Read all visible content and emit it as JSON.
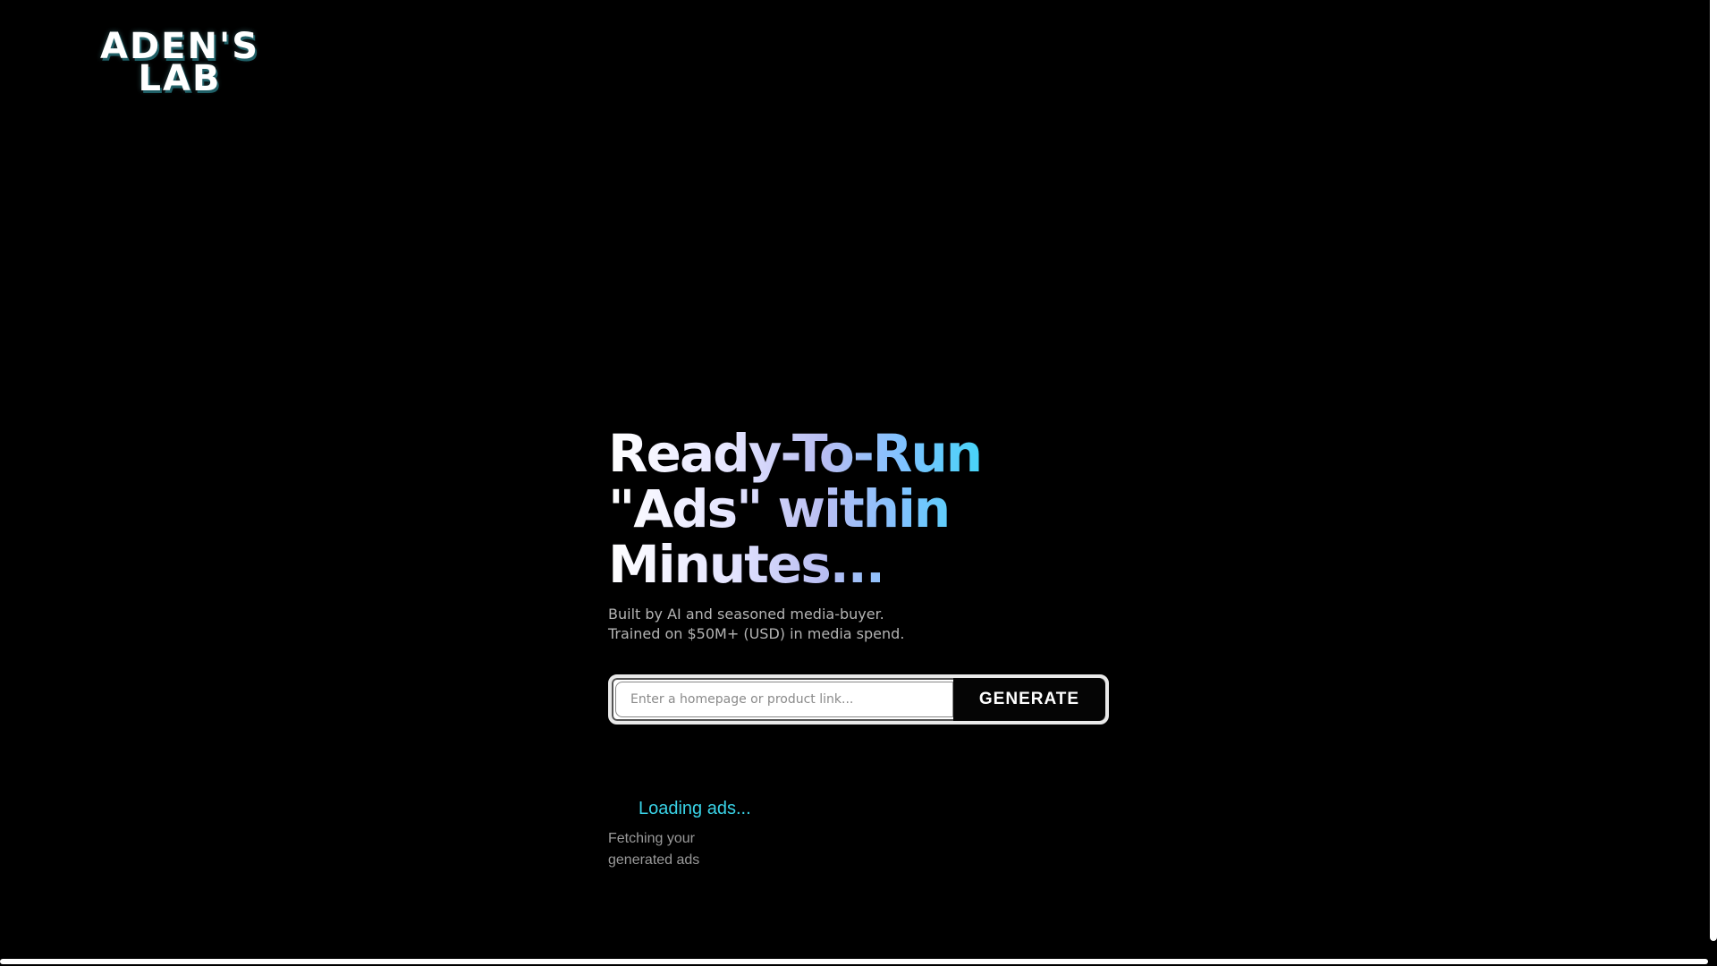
{
  "brand": {
    "line1": "ADEN'S",
    "line2": "LAB"
  },
  "hero": {
    "headline": "Ready-To-Run \"Ads\" within Minutes...",
    "sub_line1": "Built by AI and seasoned media-buyer.",
    "sub_line2": "Trained on $50M+ (USD) in media spend."
  },
  "form": {
    "input_placeholder": "Enter a homepage or product link...",
    "input_value": "",
    "button_label": "GENERATE"
  },
  "loading": {
    "title": "Loading ads...",
    "subtitle": "Fetching your generated ads"
  },
  "colors": {
    "background": "#000000",
    "accent": "#39d2e6",
    "gradient_start": "#ffffff",
    "gradient_end": "#38d9f5"
  }
}
